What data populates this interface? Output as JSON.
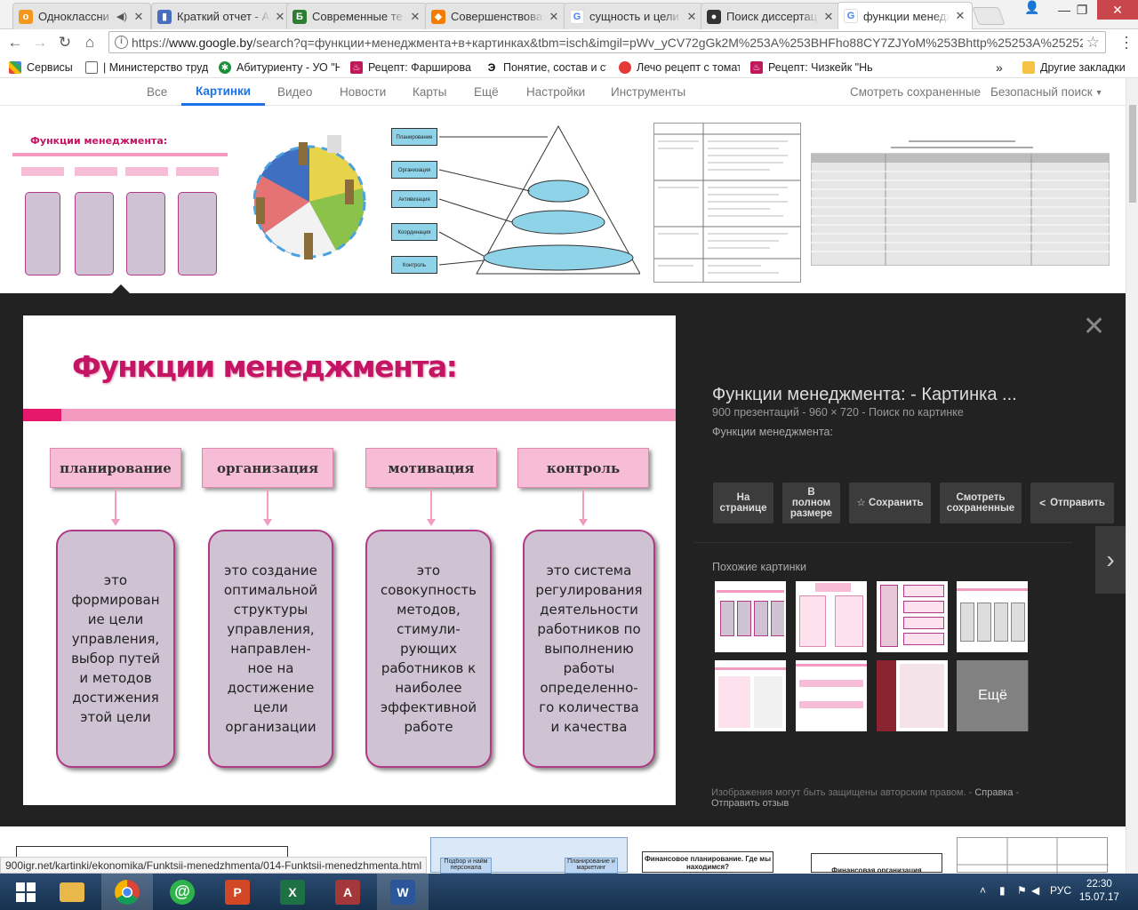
{
  "tabs": [
    {
      "label": "Одноклассни",
      "favicon": "ok-icon",
      "color": "#f5961e",
      "glyph": "о",
      "audio": true
    },
    {
      "label": "Краткий отчет - А",
      "favicon": "doc-icon",
      "color": "#4a6ebf",
      "glyph": "▮"
    },
    {
      "label": "Современные те",
      "favicon": "b-icon",
      "color": "#2e7d32",
      "glyph": "Б"
    },
    {
      "label": "Совершенствова",
      "favicon": "fire-icon",
      "color": "#f57c00",
      "glyph": "◆"
    },
    {
      "label": "сущность и цели",
      "favicon": "google-icon",
      "color": "#4285f4",
      "glyph": "G"
    },
    {
      "label": "Поиск диссертац",
      "favicon": "ball-icon",
      "color": "#333333",
      "glyph": "●"
    },
    {
      "label": "функции менедж",
      "favicon": "google-icon",
      "color": "#4285f4",
      "glyph": "G",
      "active": true
    }
  ],
  "address": {
    "url_prefix": "https://",
    "url_host": "www.google.by",
    "url_rest": "/search?q=функции+менеджмента+в+картинках&tbm=isch&imgil=pWv_yCV72gGk2M%253A%253BHFho88CY7ZJYoM%253Bhttp%25253A%25252"
  },
  "bookmarks": [
    {
      "label": "Сервисы",
      "icon": "apps-grid-icon"
    },
    {
      "label": "| Министерство труд",
      "icon": "page-icon"
    },
    {
      "label": "Абитуриенту - УО \"Н",
      "icon": "globe-icon"
    },
    {
      "label": "Рецепт: Фарширова",
      "icon": "recipe-icon"
    },
    {
      "label": "Понятие, состав и ст",
      "icon": "e-icon"
    },
    {
      "label": "Лечо рецепт с томат",
      "icon": "tomato-icon"
    },
    {
      "label": "Рецепт: Чизкейк \"Нь",
      "icon": "recipe-icon"
    },
    {
      "label": "»",
      "icon": "chevron-icon"
    },
    {
      "label": "Другие закладки",
      "icon": "folder-icon"
    }
  ],
  "search_nav": {
    "tabs": [
      "Все",
      "Картинки",
      "Видео",
      "Новости",
      "Карты",
      "Ещё",
      "Настройки",
      "Инструменты"
    ],
    "active": "Картинки",
    "saved": "Смотреть сохраненные",
    "safe": "Безопасный поиск"
  },
  "results": [
    {
      "name": "result-functions-boxes",
      "title": "Функции менеджмента:"
    },
    {
      "name": "result-people-circle"
    },
    {
      "name": "result-pyramid",
      "labels": [
        "Планирование",
        "Организация",
        "Активизация",
        "Координация",
        "Контроль"
      ]
    },
    {
      "name": "result-table-laws"
    },
    {
      "name": "result-table-functions"
    }
  ],
  "slide": {
    "title": "Функции менеджмента:",
    "functions": [
      {
        "header": "планирование",
        "body": "это\nформирован\nие цели\nуправления,\nвыбор путей\nи методов\nдостижения\nэтой цели"
      },
      {
        "header": "организация",
        "body": "это создание\nоптимальной\nструктуры\nуправления,\nнаправлен-\nное на\nдостижение\nцели\nорганизации"
      },
      {
        "header": "мотивация",
        "body": "это\nсовокупность\nметодов,\nстимули-\nрующих\nработников к\nнаиболее\nэффективной\nработе"
      },
      {
        "header": "контроль",
        "body": "это система\nрегулирования\nдеятельности\nработников по\nвыполнению\nработы\nопределенно-\nго количества\nи качества"
      }
    ]
  },
  "preview": {
    "title": "Функции менеджмента: - Картинка ...",
    "meta": "900 презентаций - 960 × 720 - Поиск по картинке",
    "description": "Функции менеджмента:",
    "buttons": {
      "visit": "На\nстранице",
      "full": "В\nполном\nразмере",
      "save": "☆ Сохранить",
      "view_saved": "Смотреть\nсохраненные",
      "share": "Отправить"
    },
    "similar_label": "Похожие картинки",
    "more": "Ещё",
    "footer_text": "Изображения могут быть защищены авторским правом.",
    "footer_help": "Справка",
    "footer_feedback": "Отправить отзыв"
  },
  "status_url": "900igr.net/kartinki/ekonomika/Funktsii-menedzhmenta/014-Funktsii-menedzhmenta.html",
  "below_thumbs": [
    {
      "text": "Подбор и найм персонала",
      "text2": "Планирование и маркетинг"
    },
    {
      "text": "Финансовое планирование. Где мы находимся?"
    },
    {
      "text": "Финансовая организация"
    }
  ],
  "taskbar": {
    "apps": [
      {
        "name": "start-button",
        "icon": "windows-icon"
      },
      {
        "name": "taskbar-explorer",
        "icon": "folder-icon",
        "color": "#e8b94a"
      },
      {
        "name": "taskbar-chrome",
        "icon": "chrome-icon",
        "color": "#4caf50",
        "active": true
      },
      {
        "name": "taskbar-mail",
        "icon": "at-icon",
        "color": "#2db34a"
      },
      {
        "name": "taskbar-powerpoint",
        "icon": "powerpoint-icon",
        "color": "#d24726",
        "glyph": "P"
      },
      {
        "name": "taskbar-excel",
        "icon": "excel-icon",
        "color": "#1e7145",
        "glyph": "X"
      },
      {
        "name": "taskbar-access",
        "icon": "access-icon",
        "color": "#a4373a",
        "glyph": "A"
      },
      {
        "name": "taskbar-word",
        "icon": "word-icon",
        "color": "#2b579a",
        "glyph": "W",
        "active": true
      }
    ],
    "lang": "РУС",
    "time": "22:30",
    "date": "15.07.17"
  }
}
